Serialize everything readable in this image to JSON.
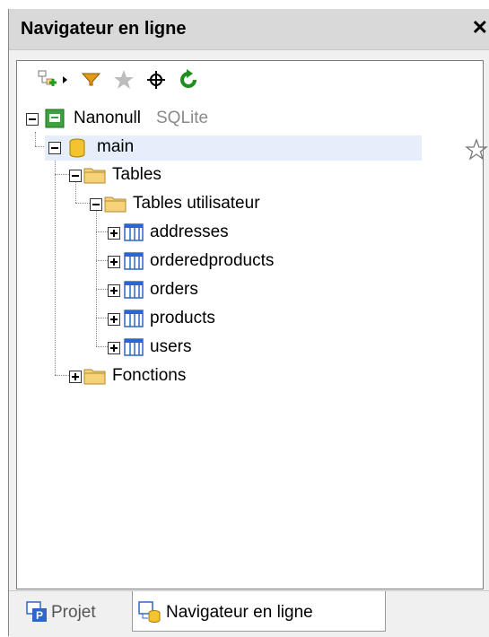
{
  "panel": {
    "title": "Navigateur en ligne",
    "close_label": "✕"
  },
  "toolbar": [
    "add-object-icon",
    "dropdown-arrow-icon",
    "filter-icon",
    "favorites-star-icon",
    "locate-icon",
    "refresh-icon"
  ],
  "tree": {
    "root": {
      "name": "Nanonull",
      "kind": "SQLite"
    },
    "database": "main",
    "tables_folder": "Tables",
    "user_tables_folder": "Tables utilisateur",
    "tables": [
      "addresses",
      "orderedproducts",
      "orders",
      "products",
      "users"
    ],
    "functions_folder": "Fonctions"
  },
  "tabs": {
    "project": "Projet",
    "online_browser": "Navigateur en ligne"
  },
  "colors": {
    "selection": "#e5eefa",
    "folder": "#f6d37a",
    "filter": "#e49b1a",
    "refresh": "#1e8e1e",
    "table_icon": "#2f66c8"
  }
}
